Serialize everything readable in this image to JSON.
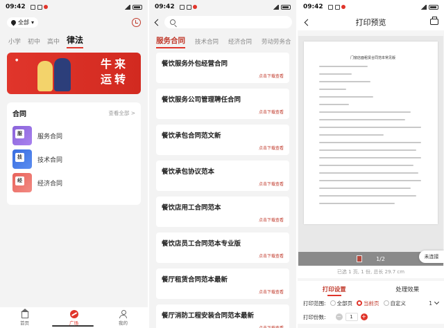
{
  "status": {
    "p1_time": "09:42",
    "p2_time": "09:42",
    "p3_time": "09:42"
  },
  "panel1": {
    "location_label": "全部",
    "tabs": [
      {
        "label": "小学",
        "active": false
      },
      {
        "label": "初中",
        "active": false
      },
      {
        "label": "高中",
        "active": false
      },
      {
        "label": "律法",
        "active": true
      }
    ],
    "banner": {
      "text_line1": "牛来",
      "text_line2": "运转"
    },
    "contracts": {
      "title": "合同",
      "more": "查看全部 >",
      "items": [
        {
          "label": "服务合同",
          "icon_label": "服",
          "color": "purple"
        },
        {
          "label": "技术合同",
          "icon_label": "技",
          "color": "blue"
        },
        {
          "label": "经济合同",
          "icon_label": "经",
          "color": "pink"
        }
      ]
    },
    "nav": {
      "home": "首页",
      "plaza": "广场",
      "mine": "我的"
    }
  },
  "panel2": {
    "tabs": [
      {
        "label": "服务合同",
        "active": true
      },
      {
        "label": "技术合同",
        "active": false
      },
      {
        "label": "经济合同",
        "active": false
      },
      {
        "label": "劳动劳务合",
        "active": false
      }
    ],
    "download_label": "点击下载查看",
    "items": [
      "餐饮服务外包经营合同",
      "餐饮服务公司管理聘任合同",
      "餐饮承包合同范文新",
      "餐饮承包协议范本",
      "餐饮店用工合同范本",
      "餐饮店员工合同范本专业版",
      "餐厅租赁合同范本最新",
      "餐厅消防工程安装合同范本最新"
    ]
  },
  "panel3": {
    "title": "打印预览",
    "doc_title": "门窗店面租赁合同范本常见版",
    "pager": "1/2",
    "float_button": "未连接",
    "info": "已选 1 页, 1 份, 总长 29.7 cm",
    "tabs": [
      {
        "label": "打印设置",
        "active": true
      },
      {
        "label": "处理效果",
        "active": false
      }
    ],
    "range": {
      "label": "打印范围:",
      "options": [
        {
          "label": "全部页",
          "selected": false
        },
        {
          "label": "当前页",
          "selected": true
        },
        {
          "label": "自定义",
          "selected": false
        }
      ],
      "custom_value": "1"
    },
    "copies": {
      "label": "打印份数:",
      "value": "1"
    }
  },
  "colors": {
    "accent": "#e0352b"
  }
}
